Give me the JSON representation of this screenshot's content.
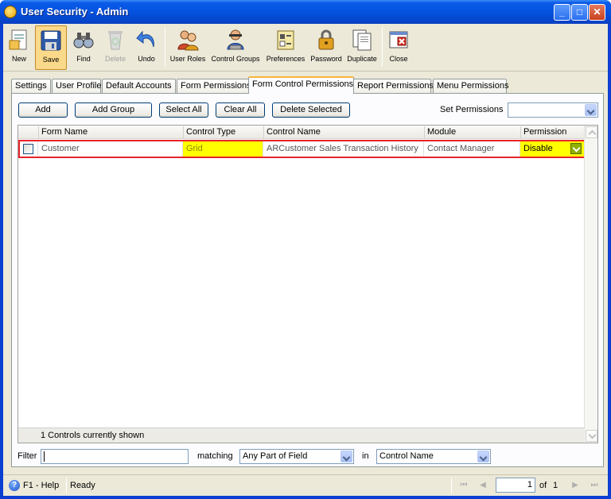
{
  "window": {
    "title": "User Security - Admin",
    "minimize": "_",
    "maximize": "□",
    "close": "✕"
  },
  "toolbar": {
    "new": "New",
    "save": "Save",
    "find": "Find",
    "delete": "Delete",
    "undo": "Undo",
    "user_roles": "User Roles",
    "control_groups": "Control Groups",
    "preferences": "Preferences",
    "password": "Password",
    "duplicate": "Duplicate",
    "close": "Close"
  },
  "tabs": [
    "Settings",
    "User Profile",
    "Default Accounts",
    "Form Permissions",
    "Form Control Permissions",
    "Report Permissions",
    "Menu Permissions"
  ],
  "selected_tab": "Form Control Permissions",
  "actions": {
    "add": "Add",
    "add_group": "Add Group",
    "select_all": "Select All",
    "clear_all": "Clear All",
    "delete_selected": "Delete Selected",
    "set_permissions_label": "Set Permissions",
    "set_permissions_value": ""
  },
  "grid": {
    "columns": [
      "Form Name",
      "Control Type",
      "Control Name",
      "Module",
      "Permission"
    ],
    "rows": [
      {
        "checked": false,
        "form_name": "Customer",
        "control_type": "Grid",
        "control_name": "ARCustomer Sales Transaction History",
        "module": "Contact Manager",
        "permission": "Disable"
      }
    ],
    "footer": "1 Controls currently shown"
  },
  "filter": {
    "label": "Filter",
    "value": "",
    "matching_label": "matching",
    "matching_value": "Any Part of Field",
    "in_label": "in",
    "in_value": "Control Name"
  },
  "status": {
    "help": "F1 - Help",
    "state": "Ready",
    "page": "1",
    "of_label": "of",
    "total_pages": "1"
  },
  "colors": {
    "highlight_yellow": "#ffff00",
    "selection_outline": "#e8242a",
    "titlebar_blue": "#0552e0"
  }
}
